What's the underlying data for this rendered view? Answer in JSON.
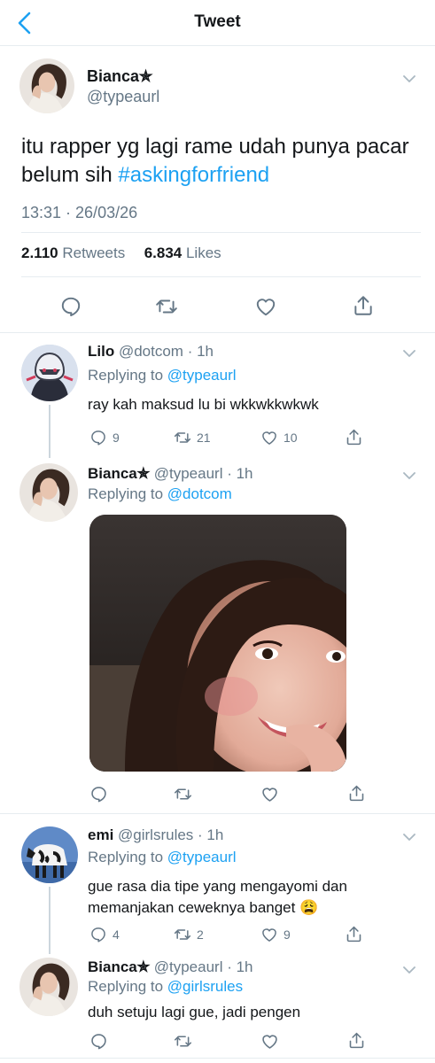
{
  "header": {
    "title": "Tweet"
  },
  "main_tweet": {
    "name": "Bianca✯",
    "handle": "@typeaurl",
    "text_plain": "itu rapper yg lagi rame udah punya pacar belum sih",
    "hashtag": "#askingforfriend",
    "timestamp": "13:31 · 26/03/26",
    "retweets_count": "2.110",
    "retweets_label": "Retweets",
    "likes_count": "6.834",
    "likes_label": "Likes"
  },
  "replies": [
    {
      "name": "Lilo",
      "handle": "@dotcom",
      "time": "· 1h",
      "replying_label": "Replying to",
      "replying_to": "@typeaurl",
      "text": "ray kah maksud lu bi wkkwkkwkwk",
      "reply_count": "9",
      "retweet_count": "21",
      "like_count": "10"
    },
    {
      "name": "Bianca✯",
      "handle": "@typeaurl",
      "time": "· 1h",
      "replying_label": "Replying to",
      "replying_to": "@dotcom",
      "text": "",
      "reply_count": "",
      "retweet_count": "",
      "like_count": ""
    },
    {
      "name": "emi",
      "handle": "@girlsrules",
      "time": "· 1h",
      "replying_label": "Replying to",
      "replying_to": "@typeaurl",
      "text_line1": "gue rasa dia tipe yang mengayomi dan",
      "text_line2": "memanjakan ceweknya banget 😩",
      "reply_count": "4",
      "retweet_count": "2",
      "like_count": "9"
    },
    {
      "name": "Bianca✯",
      "handle": "@typeaurl",
      "time": "· 1h",
      "replying_label": "Replying to",
      "replying_to": "@girlsrules",
      "text": "duh setuju lagi gue, jadi pengen",
      "reply_count": "",
      "retweet_count": "",
      "like_count": ""
    }
  ],
  "colors": {
    "accent": "#1da1f2",
    "secondary": "#657786",
    "divider": "#e6ecf0"
  }
}
